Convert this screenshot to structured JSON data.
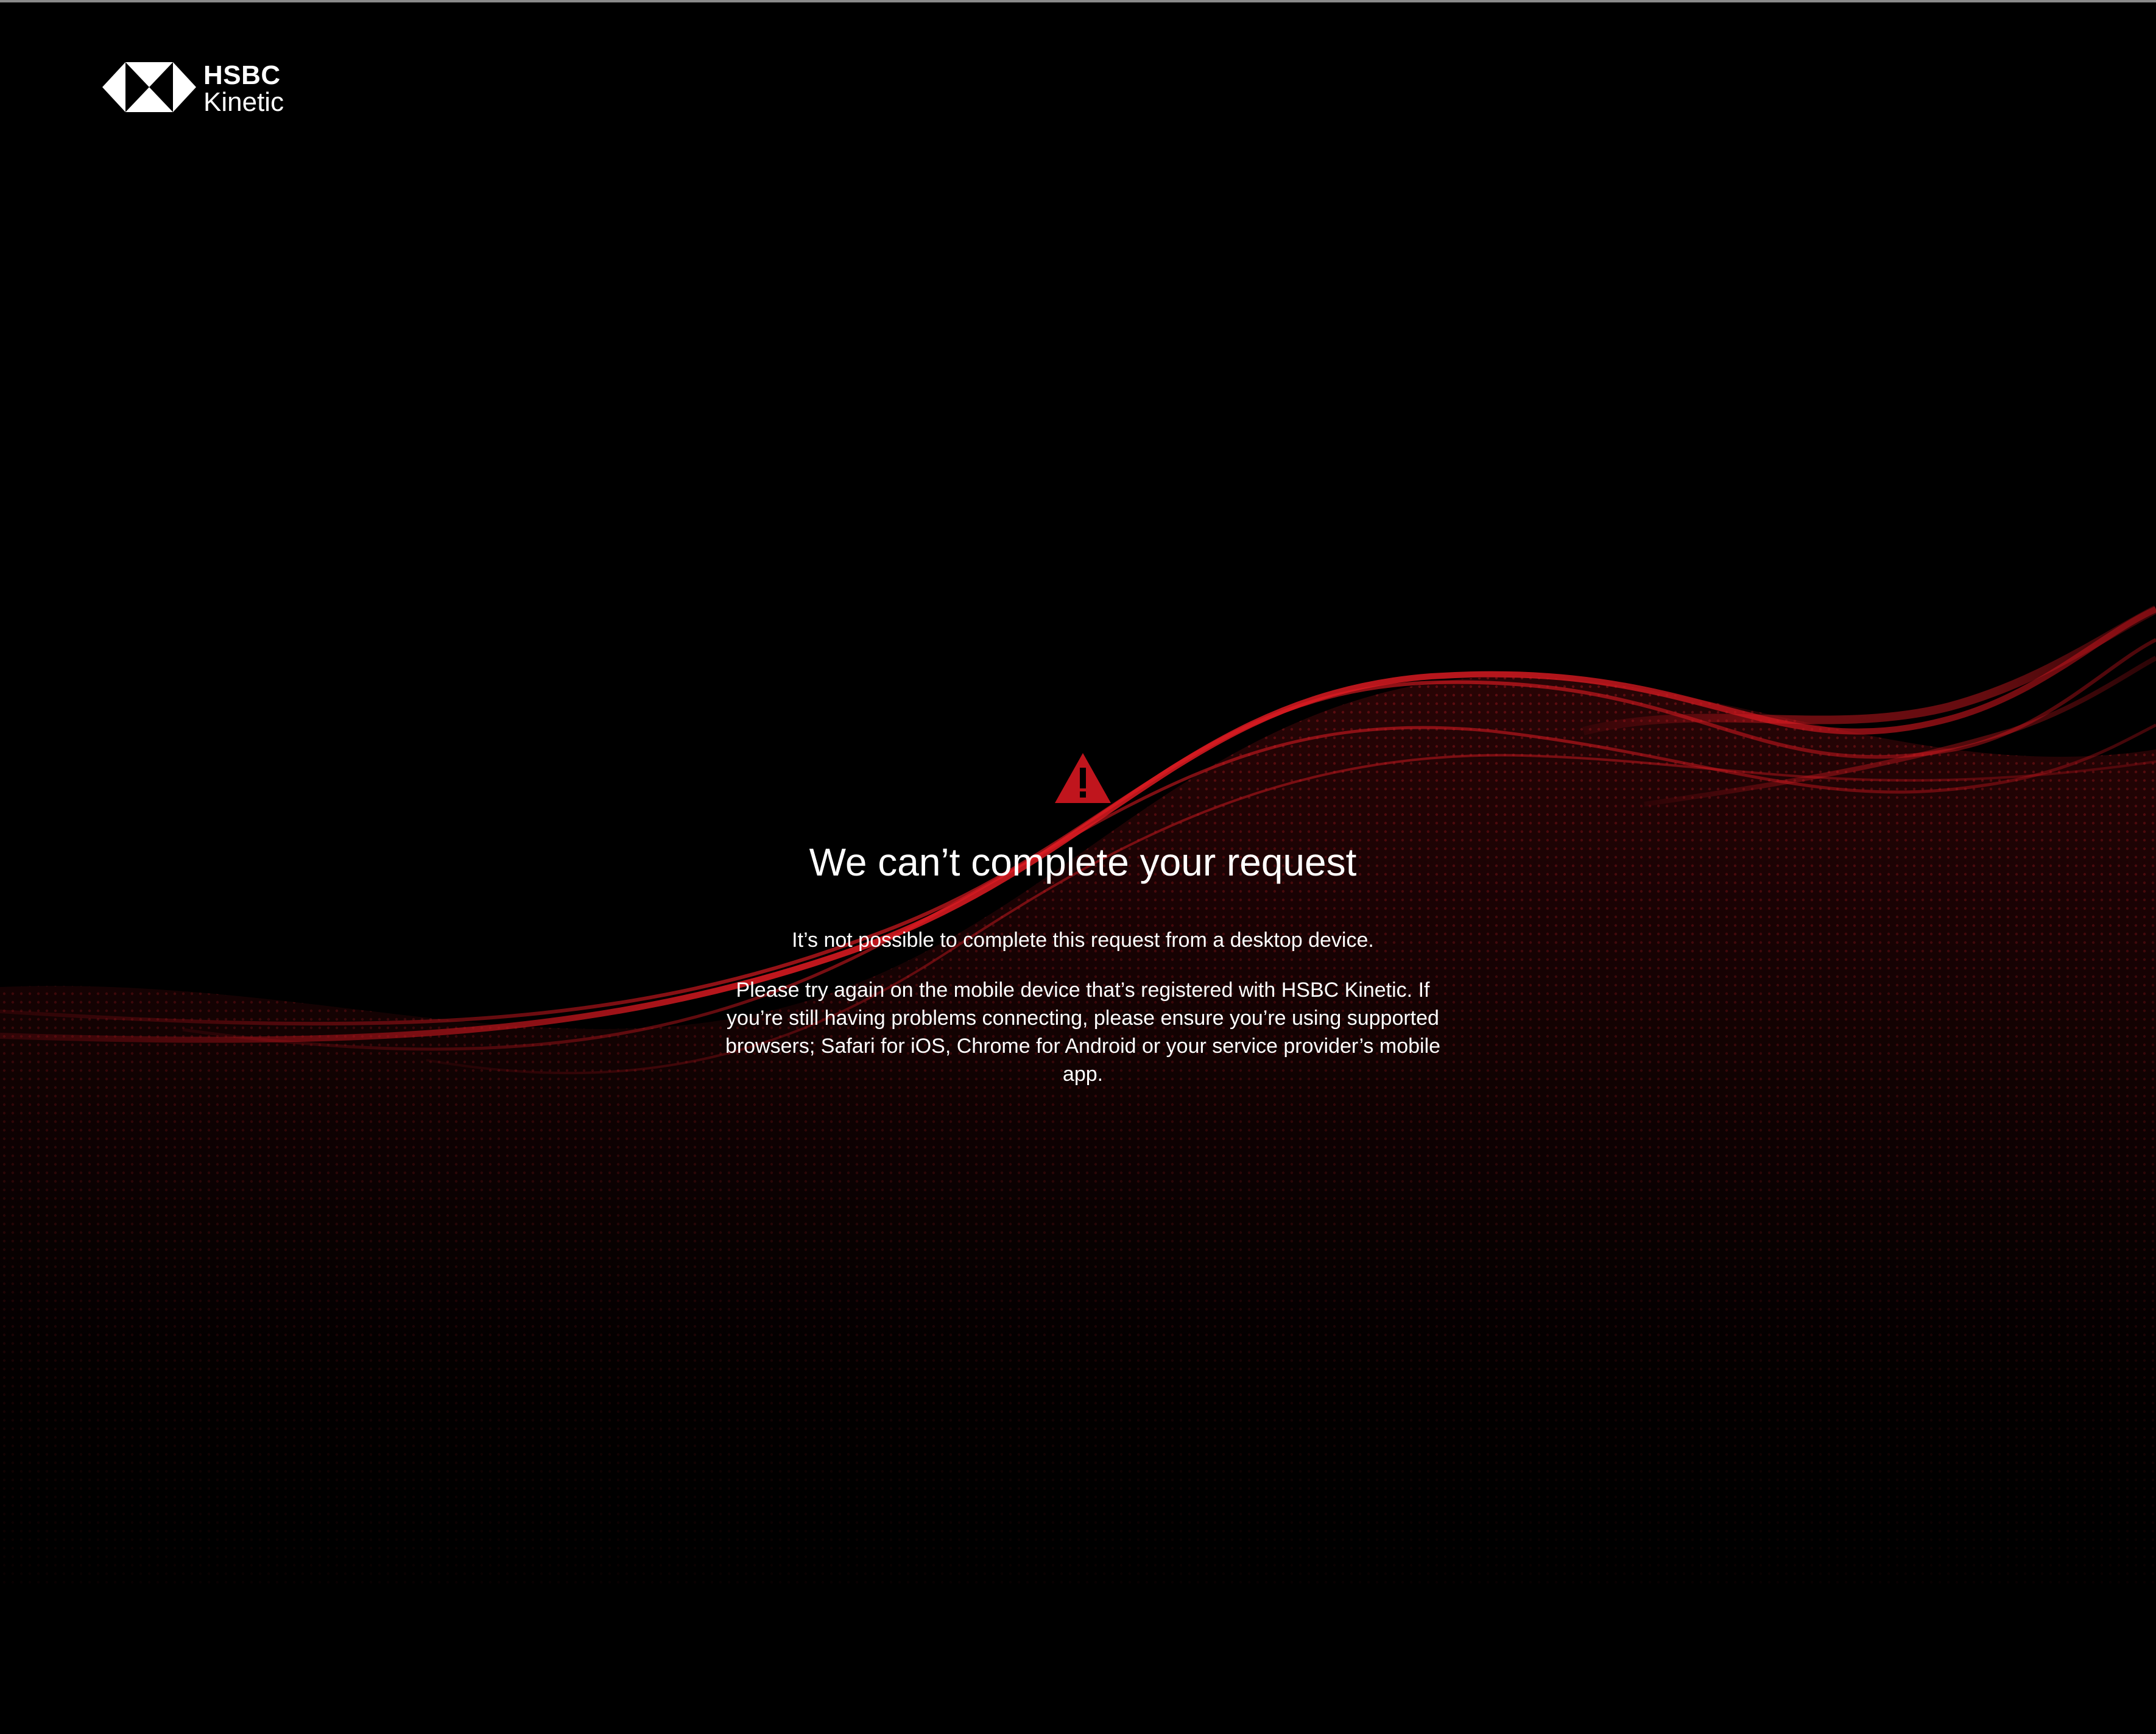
{
  "logo": {
    "brand": "HSBC",
    "product": "Kinetic",
    "icon": "hsbc-hexagon-icon"
  },
  "alert": {
    "icon": "warning-icon",
    "icon_color": "#c0151d",
    "title": "We can’t complete your request",
    "line1": "It’s not possible to complete this request from a desktop device.",
    "line2": "Please try again on the mobile device that’s registered with HSBC Kinetic. If you’re still having problems connecting, please ensure you’re using supported browsers; Safari for iOS, Chrome for Android or your service provider’s mobile app."
  },
  "theme": {
    "background": "#000000",
    "wave_color": "#d4141c",
    "text_color": "#ffffff"
  }
}
